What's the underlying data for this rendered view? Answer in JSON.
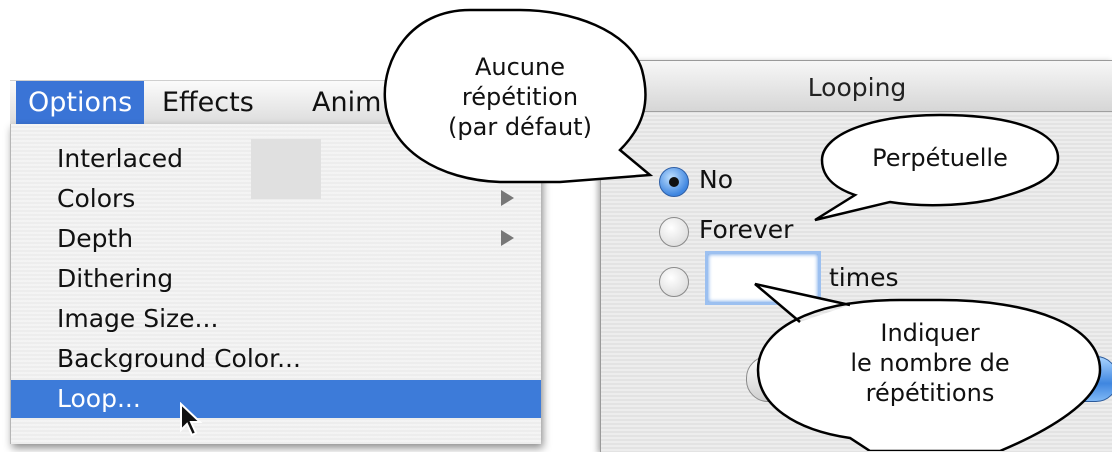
{
  "menubar": {
    "items": [
      {
        "label": "Options",
        "active": true
      },
      {
        "label": "Effects"
      },
      {
        "label": "Anim"
      }
    ]
  },
  "dropdown": {
    "items": [
      {
        "label": "Interlaced",
        "submenu": false
      },
      {
        "label": "Colors",
        "submenu": true
      },
      {
        "label": "Depth",
        "submenu": true
      },
      {
        "label": "Dithering",
        "submenu": false
      },
      {
        "label": "Image Size...",
        "submenu": false
      },
      {
        "label": "Background Color...",
        "submenu": false
      },
      {
        "label": "Loop...",
        "submenu": false,
        "highlighted": true
      }
    ]
  },
  "dialog": {
    "title": "Looping",
    "options": [
      {
        "label": "No",
        "selected": true
      },
      {
        "label": "Forever",
        "selected": false
      },
      {
        "label": "",
        "selected": false
      }
    ],
    "times_value": "",
    "times_label": "times"
  },
  "callouts": {
    "no_repeat": [
      "Aucune",
      "répétition",
      "(par défaut)"
    ],
    "forever": [
      "Perpétuelle"
    ],
    "count": [
      "Indiquer",
      "le nombre de",
      "répétitions"
    ]
  },
  "colors": {
    "menu_highlight": "#3d7bd9",
    "radio_selected": "#3f86e0",
    "input_focus": "#9cc0f0"
  }
}
